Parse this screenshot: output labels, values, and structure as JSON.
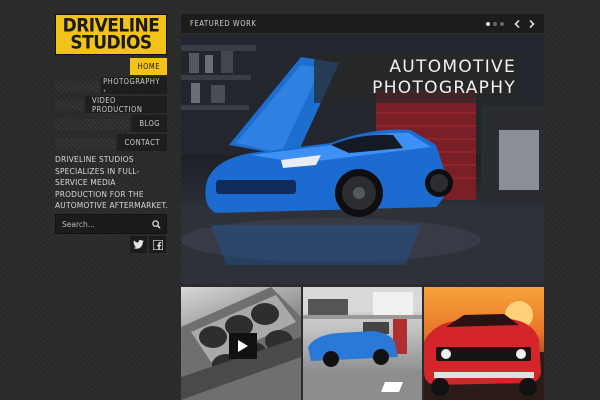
{
  "brand": {
    "line1": "DRIVELINE",
    "line2": "STUDIOS",
    "color": "#f3c317"
  },
  "nav": {
    "items": [
      {
        "label": "HOME",
        "active": true
      },
      {
        "label": "PHOTOGRAPHY ›",
        "active": false
      },
      {
        "label": "VIDEO PRODUCTION",
        "active": false
      },
      {
        "label": "BLOG",
        "active": false
      },
      {
        "label": "CONTACT",
        "active": false
      }
    ]
  },
  "tagline": "DRIVELINE STUDIOS SPECIALIZES IN FULL-SERVICE MEDIA PRODUCTION FOR THE AUTOMOTIVE AFTERMARKET.",
  "search": {
    "placeholder": "Search...",
    "icon": "search-icon"
  },
  "social": [
    {
      "icon": "twitter-icon"
    },
    {
      "icon": "facebook-icon"
    }
  ],
  "featured": {
    "title": "FEATURED WORK",
    "slides_count": 3,
    "active_slide": 1,
    "prev_icon": "chevron-left-icon",
    "next_icon": "chevron-right-icon"
  },
  "hero": {
    "caption_line1": "AUTOMOTIVE",
    "caption_line2": "PHOTOGRAPHY"
  },
  "thumbnails": [
    {
      "name": "engine-block-video",
      "has_play": true
    },
    {
      "name": "blue-corvette-garage",
      "has_play": false
    },
    {
      "name": "red-challenger-sunset",
      "has_play": false
    }
  ]
}
